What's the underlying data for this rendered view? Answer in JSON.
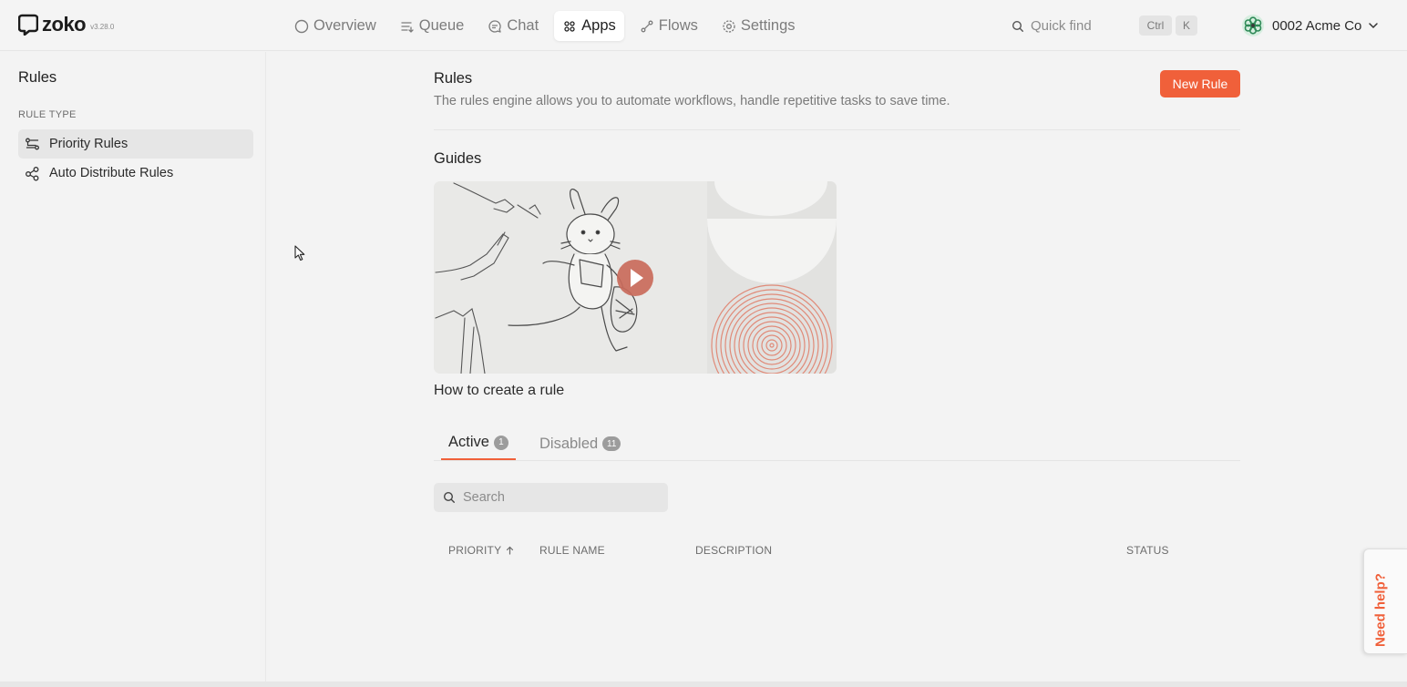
{
  "app": {
    "logo_text": "zoko",
    "version": "v3.28.0"
  },
  "nav": {
    "items": [
      {
        "label": "Overview",
        "icon": "circle-icon"
      },
      {
        "label": "Queue",
        "icon": "queue-icon"
      },
      {
        "label": "Chat",
        "icon": "chat-icon"
      },
      {
        "label": "Apps",
        "icon": "apps-grid-icon",
        "active": true
      },
      {
        "label": "Flows",
        "icon": "flows-icon"
      },
      {
        "label": "Settings",
        "icon": "gear-icon"
      }
    ]
  },
  "quick_find": {
    "placeholder": "Quick find",
    "shortcut_ctrl": "Ctrl",
    "shortcut_key": "K"
  },
  "account": {
    "name": "0002 Acme Co"
  },
  "sidebar": {
    "title": "Rules",
    "section": "RULE TYPE",
    "items": [
      {
        "label": "Priority Rules",
        "icon": "priority-rules-icon",
        "selected": true
      },
      {
        "label": "Auto Distribute Rules",
        "icon": "distribute-icon"
      }
    ]
  },
  "main": {
    "title": "Rules",
    "description": "The rules engine allows you to automate workflows, handle repetitive tasks to save time.",
    "new_rule_label": "New Rule",
    "guides_title": "Guides",
    "video_caption": "How to create a rule"
  },
  "tabs": [
    {
      "label": "Active",
      "count": "1",
      "active": true
    },
    {
      "label": "Disabled",
      "count": "11"
    }
  ],
  "search": {
    "placeholder": "Search"
  },
  "table": {
    "columns": [
      "PRIORITY",
      "RULE NAME",
      "DESCRIPTION",
      "STATUS"
    ],
    "sort_column": "PRIORITY",
    "sort_direction": "ascending",
    "rows": []
  },
  "help": {
    "label": "Need help?"
  },
  "colors": {
    "accent": "#f0603a",
    "background": "#f3f3f3"
  }
}
